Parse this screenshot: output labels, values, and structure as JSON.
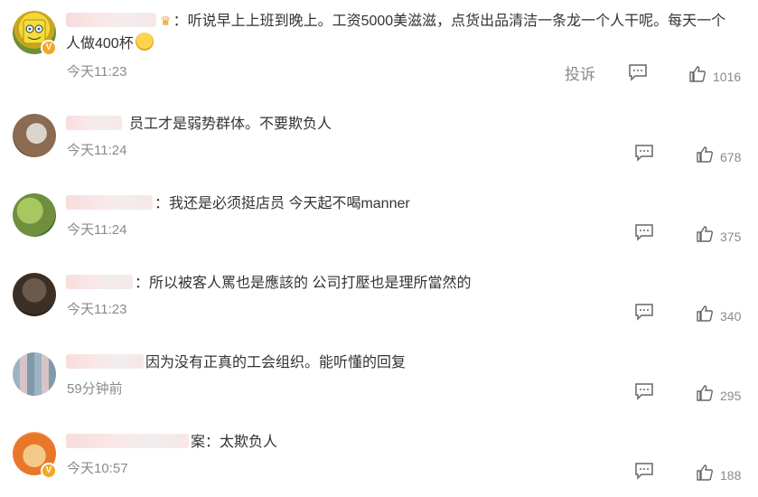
{
  "comments": [
    {
      "text": "：听说早上上班到晚上。工资5000美滋滋，点货出品清洁一条龙一个人干呢。每天一个",
      "text_line2": "人做400杯",
      "time": "今天11:23",
      "report": "投诉",
      "likes": "1016",
      "avatar_icon": "spongebob-avatar",
      "emoji_icon": "crying-emoji"
    },
    {
      "text": "员工才是弱势群体。不要欺负人",
      "time": "今天11:24",
      "likes": "678",
      "avatar_icon": "photo-avatar"
    },
    {
      "text": "：我还是必须挺店员 今天起不喝manner",
      "time": "今天11:24",
      "likes": "375",
      "avatar_icon": "green-avatar"
    },
    {
      "text": "：所以被客人罵也是應該的 公司打壓也是理所當然的",
      "time": "今天11:23",
      "likes": "340",
      "avatar_icon": "dark-avatar"
    },
    {
      "text": "因为没有正真的工会组织。能听懂的回复",
      "time": "59分钟前",
      "likes": "295",
      "avatar_icon": "pixel-avatar"
    },
    {
      "text": "案：太欺负人",
      "time": "今天10:57",
      "likes": "188",
      "avatar_icon": "cartoon-avatar"
    }
  ],
  "colors": {
    "text": "#333333",
    "meta": "#8a8a8a",
    "badge": "#f5a623"
  }
}
